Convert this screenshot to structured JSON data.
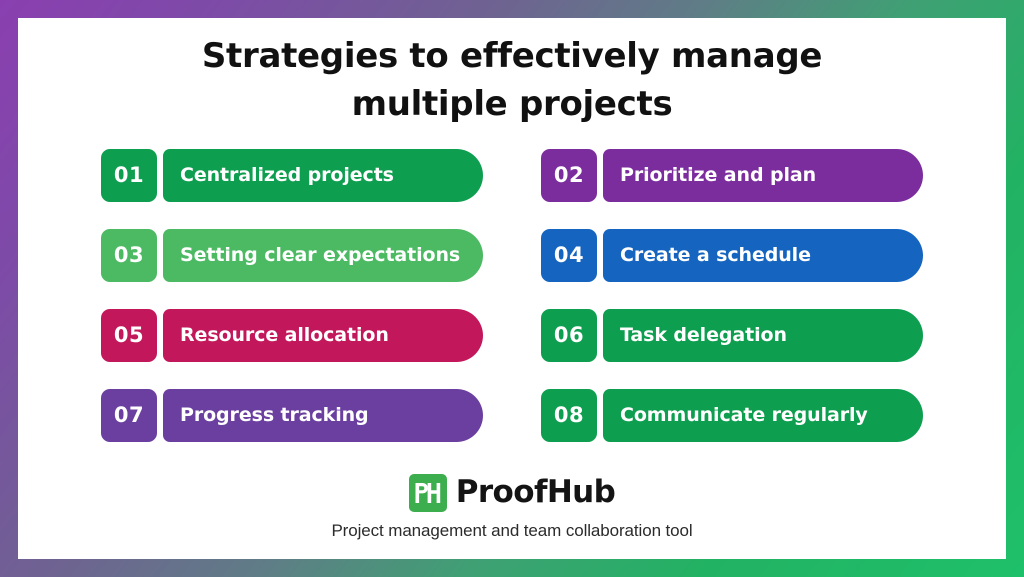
{
  "frame": {
    "gradient_start": "#8A3FB0",
    "gradient_mid": "#5F7D86",
    "gradient_end": "#1FC06A"
  },
  "title": {
    "line1": "Strategies to effectively manage",
    "line2": "multiple projects",
    "color": "#111111"
  },
  "items": [
    {
      "number": "01",
      "label": "Centralized projects",
      "color": "#0E9E4F"
    },
    {
      "number": "02",
      "label": "Prioritize and plan",
      "color": "#7B2D9E"
    },
    {
      "number": "03",
      "label": "Setting clear expectations",
      "color": "#4CB963"
    },
    {
      "number": "04",
      "label": "Create a schedule",
      "color": "#1565C0"
    },
    {
      "number": "05",
      "label": "Resource allocation",
      "color": "#C2185B"
    },
    {
      "number": "06",
      "label": "Task delegation",
      "color": "#0E9E4F"
    },
    {
      "number": "07",
      "label": "Progress tracking",
      "color": "#6B3FA0"
    },
    {
      "number": "08",
      "label": "Communicate regularly",
      "color": "#0E9E4F"
    }
  ],
  "brand": {
    "logo_mark_text": "PH",
    "logo_mark_color": "#3DAE4E",
    "name": "ProofHub",
    "tagline": "Project management and team collaboration tool"
  }
}
